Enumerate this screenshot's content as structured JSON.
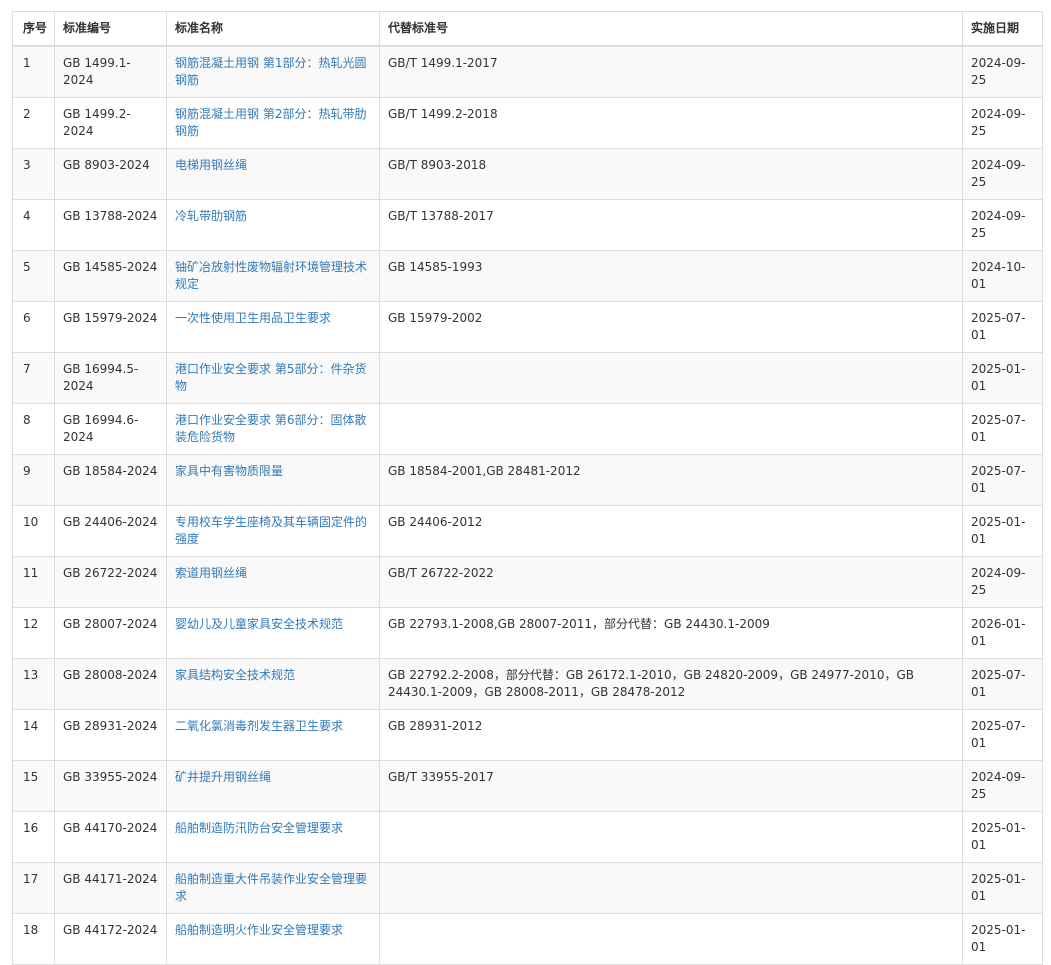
{
  "table": {
    "headers": [
      "序号",
      "标准编号",
      "标准名称",
      "代替标准号",
      "实施日期"
    ],
    "rows": [
      {
        "no": "1",
        "code": "GB 1499.1-2024",
        "name": "钢筋混凝土用钢 第1部分：热轧光圆钢筋",
        "replaces": "GB/T 1499.1-2017",
        "date": "2024-09-25"
      },
      {
        "no": "2",
        "code": "GB 1499.2-2024",
        "name": "钢筋混凝土用钢 第2部分：热轧带肋钢筋",
        "replaces": "GB/T 1499.2-2018",
        "date": "2024-09-25"
      },
      {
        "no": "3",
        "code": "GB 8903-2024",
        "name": "电梯用钢丝绳",
        "replaces": "GB/T 8903-2018",
        "date": "2024-09-25"
      },
      {
        "no": "4",
        "code": "GB 13788-2024",
        "name": "冷轧带肋钢筋",
        "replaces": "GB/T 13788-2017",
        "date": "2024-09-25"
      },
      {
        "no": "5",
        "code": "GB 14585-2024",
        "name": "铀矿冶放射性废物辐射环境管理技术规定",
        "replaces": "GB 14585-1993",
        "date": "2024-10-01"
      },
      {
        "no": "6",
        "code": "GB 15979-2024",
        "name": "一次性使用卫生用品卫生要求",
        "replaces": "GB 15979-2002",
        "date": "2025-07-01"
      },
      {
        "no": "7",
        "code": "GB 16994.5-2024",
        "name": "港口作业安全要求 第5部分：件杂货物",
        "replaces": "",
        "date": "2025-01-01"
      },
      {
        "no": "8",
        "code": "GB 16994.6-2024",
        "name": "港口作业安全要求 第6部分：固体散装危险货物",
        "replaces": "",
        "date": "2025-07-01"
      },
      {
        "no": "9",
        "code": "GB 18584-2024",
        "name": "家具中有害物质限量",
        "replaces": "GB 18584-2001,GB 28481-2012",
        "date": "2025-07-01"
      },
      {
        "no": "10",
        "code": "GB 24406-2024",
        "name": "专用校车学生座椅及其车辆固定件的强度",
        "replaces": "GB 24406-2012",
        "date": "2025-01-01"
      },
      {
        "no": "11",
        "code": "GB 26722-2024",
        "name": "索道用钢丝绳",
        "replaces": "GB/T 26722-2022",
        "date": "2024-09-25"
      },
      {
        "no": "12",
        "code": "GB 28007-2024",
        "name": "婴幼儿及儿童家具安全技术规范",
        "replaces": "GB 22793.1-2008,GB 28007-2011，部分代替：GB 24430.1-2009",
        "date": "2026-01-01"
      },
      {
        "no": "13",
        "code": "GB 28008-2024",
        "name": "家具结构安全技术规范",
        "replaces": "GB 22792.2-2008，部分代替：GB 26172.1-2010，GB 24820-2009，GB 24977-2010，GB 24430.1-2009，GB 28008-2011，GB 28478-2012",
        "date": "2025-07-01"
      },
      {
        "no": "14",
        "code": "GB 28931-2024",
        "name": "二氧化氯消毒剂发生器卫生要求",
        "replaces": "GB 28931-2012",
        "date": "2025-07-01"
      },
      {
        "no": "15",
        "code": "GB 33955-2024",
        "name": "矿井提升用钢丝绳",
        "replaces": "GB/T 33955-2017",
        "date": "2024-09-25"
      },
      {
        "no": "16",
        "code": "GB 44170-2024",
        "name": "船舶制造防汛防台安全管理要求",
        "replaces": "",
        "date": "2025-01-01"
      },
      {
        "no": "17",
        "code": "GB 44171-2024",
        "name": "船舶制造重大件吊装作业安全管理要求",
        "replaces": "",
        "date": "2025-01-01"
      },
      {
        "no": "18",
        "code": "GB 44172-2024",
        "name": "船舶制造明火作业安全管理要求",
        "replaces": "",
        "date": "2025-01-01"
      }
    ]
  },
  "colors": {
    "link": "#337ab7",
    "border": "#dddddd",
    "stripe": "#f9f9f9",
    "text": "#333333"
  }
}
